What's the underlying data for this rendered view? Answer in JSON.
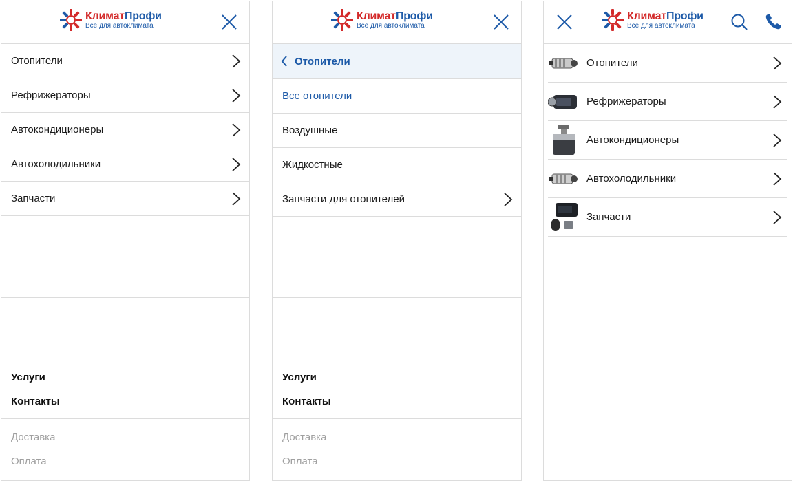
{
  "brand": {
    "name_part1": "Климат",
    "name_part2": "Профи",
    "tagline": "Всё для автоклимата",
    "red": "#d32a2a",
    "blue": "#1d5aa8"
  },
  "panel1": {
    "menu": [
      {
        "label": "Отопители"
      },
      {
        "label": "Рефрижераторы"
      },
      {
        "label": "Автокондиционеры"
      },
      {
        "label": "Автохолодильники"
      },
      {
        "label": "Запчасти"
      }
    ],
    "bottom_primary": [
      "Услуги",
      "Контакты"
    ],
    "bottom_secondary": [
      "Доставка",
      "Оплата"
    ]
  },
  "panel2": {
    "back_label": "Отопители",
    "menu": [
      {
        "label": "Все отопители"
      },
      {
        "label": "Воздушные"
      },
      {
        "label": "Жидкостные"
      },
      {
        "label": "Запчасти для отопителей"
      }
    ],
    "bottom_primary": [
      "Услуги",
      "Контакты"
    ],
    "bottom_secondary": [
      "Доставка",
      "Оплата"
    ]
  },
  "panel3": {
    "categories": [
      {
        "label": "Отопители",
        "icon": "heater-icon"
      },
      {
        "label": "Рефрижераторы",
        "icon": "refrigerator-unit-icon"
      },
      {
        "label": "Автокондиционеры",
        "icon": "air-conditioner-icon"
      },
      {
        "label": "Автохолодильники",
        "icon": "car-fridge-icon"
      },
      {
        "label": "Запчасти",
        "icon": "spare-parts-icon"
      }
    ]
  },
  "icons": {
    "close": "close-icon",
    "chevron": "chevron-right-icon",
    "back": "chevron-left-icon",
    "search": "search-icon",
    "phone": "phone-icon"
  }
}
